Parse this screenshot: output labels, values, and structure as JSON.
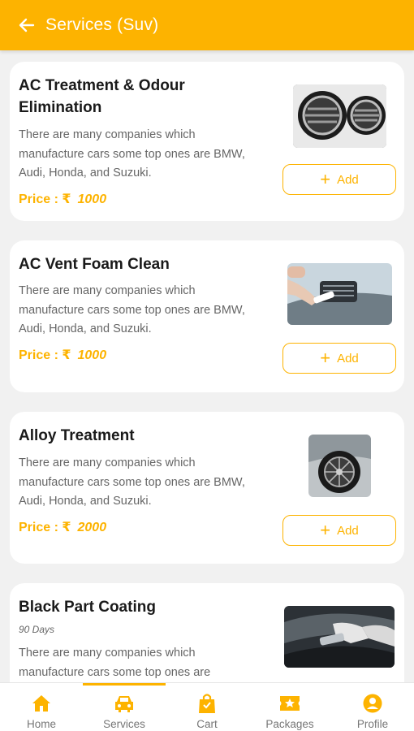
{
  "header": {
    "title": "Services (Suv)"
  },
  "colors": {
    "accent": "#fdb300",
    "card": "#ffffff",
    "background": "#f1f1f1"
  },
  "services": [
    {
      "name": "AC Treatment & Odour Elimination",
      "subtitle": "",
      "description": "There are many companies which manufacture cars some top ones are BMW, Audi, Honda, and Suzuki.",
      "price_label": "Price : ₹",
      "price": "1000",
      "add_label": "Add",
      "image": "ac-vents-image"
    },
    {
      "name": "AC Vent Foam Clean",
      "subtitle": "",
      "description": "There are many companies which manufacture cars some top ones are BMW, Audi, Honda, and Suzuki.",
      "price_label": "Price : ₹",
      "price": "1000",
      "add_label": "Add",
      "image": "vent-cleaning-image"
    },
    {
      "name": "Alloy Treatment",
      "subtitle": "",
      "description": "There are many companies which manufacture cars some top ones are BMW, Audi, Honda, and Suzuki.",
      "price_label": "Price : ₹",
      "price": "2000",
      "add_label": "Add",
      "image": "alloy-wheel-image"
    },
    {
      "name": "Black Part Coating",
      "subtitle": "90 Days",
      "description": "There are many companies which manufacture cars some top ones are",
      "price_label": "",
      "price": "",
      "add_label": "",
      "image": "coating-image"
    }
  ],
  "nav": [
    {
      "label": "Home",
      "icon": "home-icon"
    },
    {
      "label": "Services",
      "icon": "car-icon",
      "active": true
    },
    {
      "label": "Cart",
      "icon": "shopping-bag-icon"
    },
    {
      "label": "Packages",
      "icon": "ticket-icon"
    },
    {
      "label": "Profile",
      "icon": "user-icon"
    }
  ]
}
